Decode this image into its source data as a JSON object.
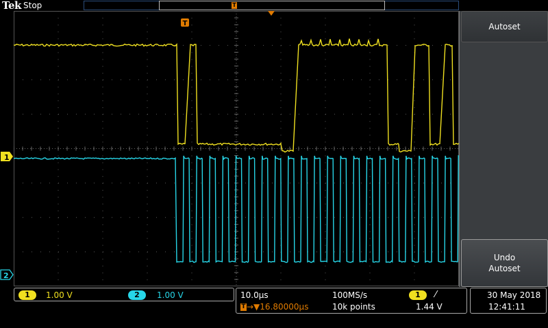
{
  "header": {
    "brand": "Tek",
    "run_state": "Stop",
    "trigger_marker": "T"
  },
  "channels": {
    "ch1": {
      "number": "1",
      "scale": "1.00 V",
      "color": "#f0e020"
    },
    "ch2": {
      "number": "2",
      "scale": "1.00 V",
      "color": "#27d6e8"
    }
  },
  "timebase": {
    "horizontal_scale": "10.0µs",
    "trigger_delay": "16.80000µs",
    "sample_rate": "100MS/s",
    "record_length": "10k points"
  },
  "trigger": {
    "source": "1",
    "slope_symbol": "⁄",
    "level": "1.44 V",
    "color": "#e07b00"
  },
  "datetime": {
    "date": "30 May 2018",
    "time": "12:41:11"
  },
  "side_menu": {
    "autoset": "Autoset",
    "undo_line1": "Undo",
    "undo_line2": "Autoset"
  }
}
